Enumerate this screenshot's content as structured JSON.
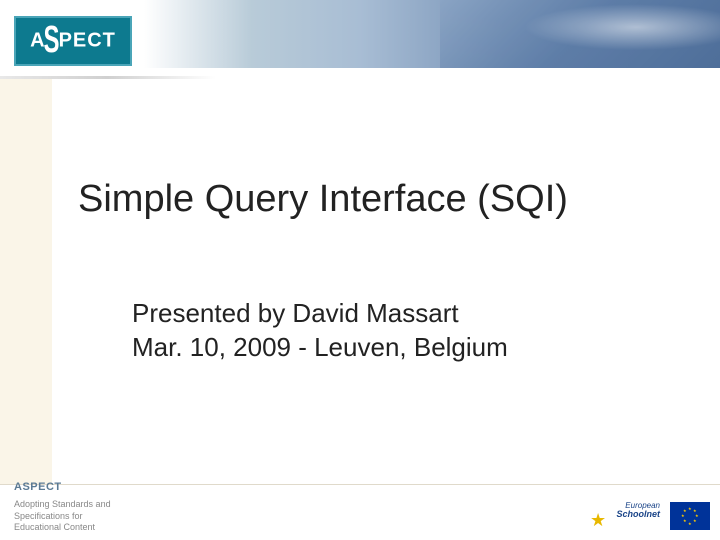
{
  "header": {
    "logo_text_pre": "A",
    "logo_text_s": "S",
    "logo_text_post": "PECT"
  },
  "main": {
    "title": "Simple Query Interface (SQI)",
    "presenter": "Presented by David Massart",
    "date_location": "Mar. 10, 2009 - Leuven, Belgium"
  },
  "footer": {
    "brand": "ASPECT",
    "tagline_l1": "Adopting Standards and",
    "tagline_l2": "Specifications for",
    "tagline_l3": "Educational Content",
    "eun_top": "European",
    "eun_bottom": "Schoolnet"
  }
}
